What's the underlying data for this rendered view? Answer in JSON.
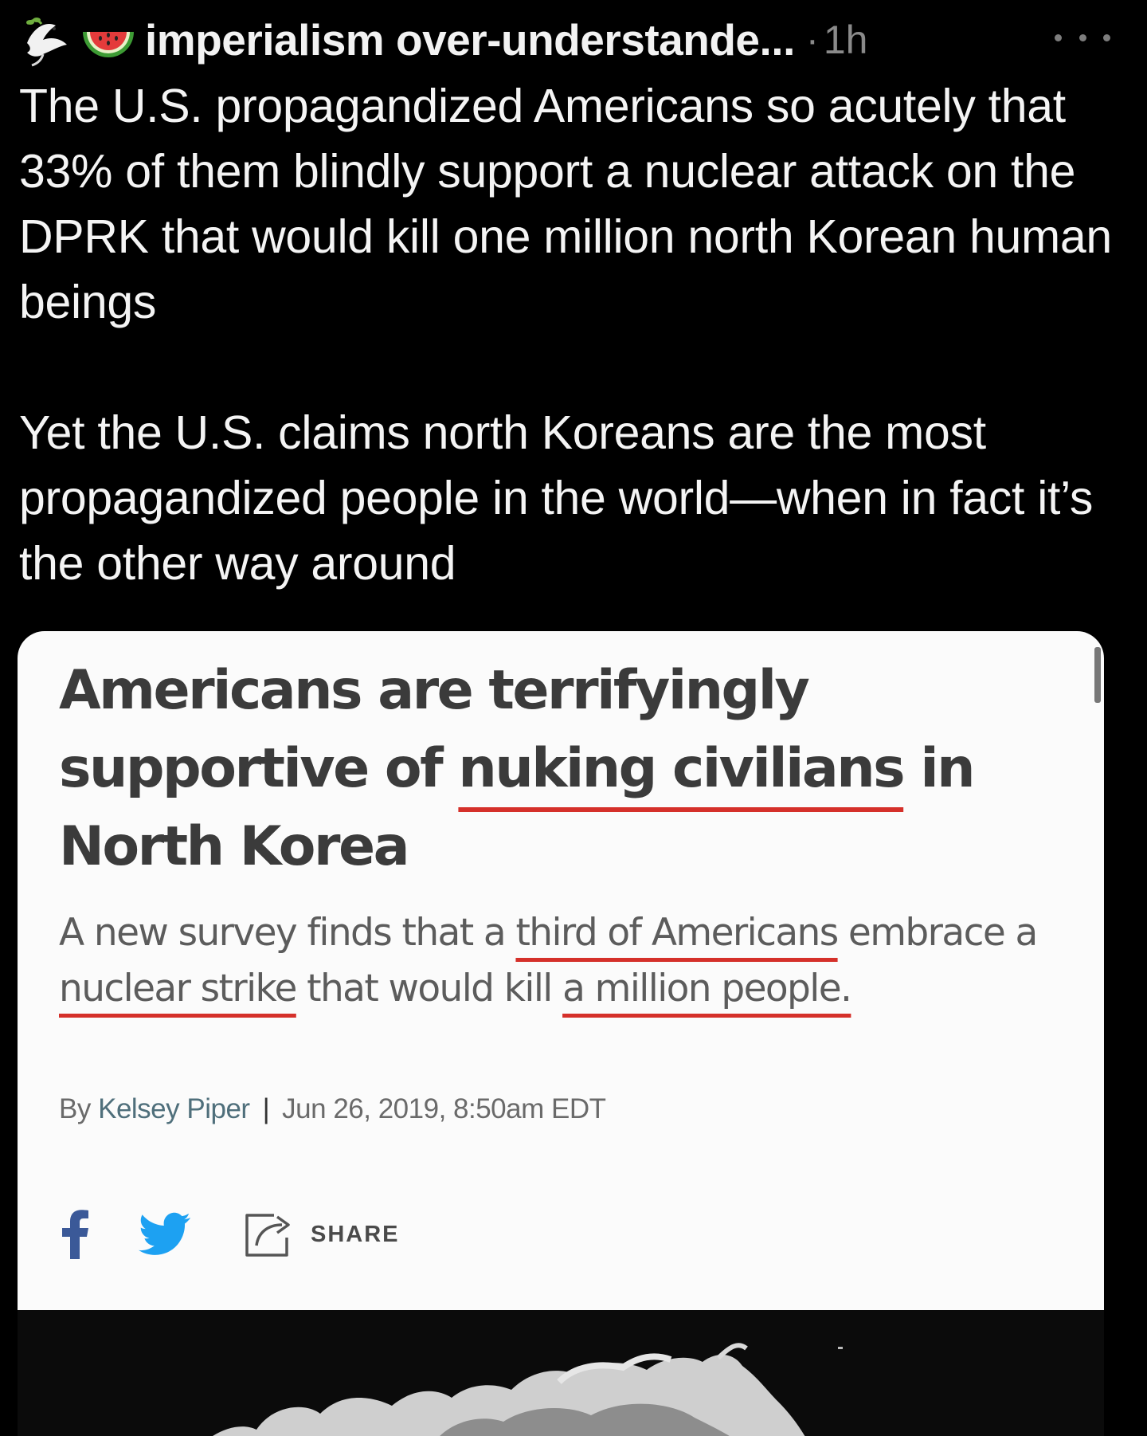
{
  "tweet": {
    "author": "imperialism over-understande...",
    "separator": "·",
    "time": "1h",
    "paragraphs": [
      "The U.S. propagandized Americans so acutely that 33% of them blindly support a nuclear attack on the DPRK that would kill one million north Korean human beings",
      "Yet the U.S. claims north Koreans are the most propagandized people in the world—when in fact it’s the other way around"
    ],
    "icons": [
      "dove-icon",
      "watermelon-icon",
      "more-options-icon"
    ]
  },
  "article": {
    "headline": {
      "part1": "Americans are terrifyingly supportive of ",
      "underlined": "nuking civilians",
      "part2": " in North Korea"
    },
    "dek": {
      "t1": "A new survey finds that a ",
      "u1": "third of Americans",
      "t2": " embrace a ",
      "u2": "nuclear strike",
      "t3": " that would kill ",
      "u3": "a million people."
    },
    "byline": {
      "prefix": "By",
      "author": "Kelsey Piper",
      "separator": "|",
      "date": "Jun 26, 2019, 8:50am EDT"
    },
    "share": {
      "icons": [
        "facebook-icon",
        "twitter-icon",
        "share-icon"
      ],
      "share_label": "SHARE"
    },
    "colors": {
      "underline": "#d5302a",
      "facebook": "#3b5998",
      "twitter": "#1da1f2"
    }
  }
}
